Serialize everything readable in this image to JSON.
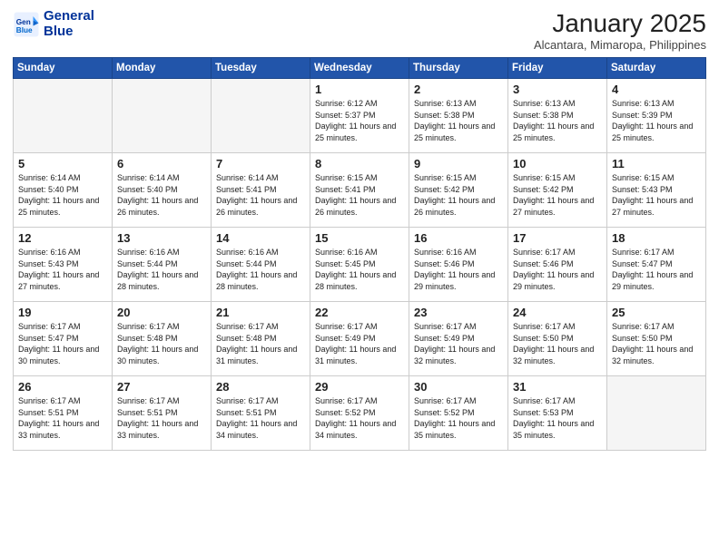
{
  "logo": {
    "line1": "General",
    "line2": "Blue"
  },
  "title": "January 2025",
  "location": "Alcantara, Mimaropa, Philippines",
  "weekdays": [
    "Sunday",
    "Monday",
    "Tuesday",
    "Wednesday",
    "Thursday",
    "Friday",
    "Saturday"
  ],
  "weeks": [
    [
      {
        "day": "",
        "info": ""
      },
      {
        "day": "",
        "info": ""
      },
      {
        "day": "",
        "info": ""
      },
      {
        "day": "1",
        "info": "Sunrise: 6:12 AM\nSunset: 5:37 PM\nDaylight: 11 hours\nand 25 minutes."
      },
      {
        "day": "2",
        "info": "Sunrise: 6:13 AM\nSunset: 5:38 PM\nDaylight: 11 hours\nand 25 minutes."
      },
      {
        "day": "3",
        "info": "Sunrise: 6:13 AM\nSunset: 5:38 PM\nDaylight: 11 hours\nand 25 minutes."
      },
      {
        "day": "4",
        "info": "Sunrise: 6:13 AM\nSunset: 5:39 PM\nDaylight: 11 hours\nand 25 minutes."
      }
    ],
    [
      {
        "day": "5",
        "info": "Sunrise: 6:14 AM\nSunset: 5:40 PM\nDaylight: 11 hours\nand 25 minutes."
      },
      {
        "day": "6",
        "info": "Sunrise: 6:14 AM\nSunset: 5:40 PM\nDaylight: 11 hours\nand 26 minutes."
      },
      {
        "day": "7",
        "info": "Sunrise: 6:14 AM\nSunset: 5:41 PM\nDaylight: 11 hours\nand 26 minutes."
      },
      {
        "day": "8",
        "info": "Sunrise: 6:15 AM\nSunset: 5:41 PM\nDaylight: 11 hours\nand 26 minutes."
      },
      {
        "day": "9",
        "info": "Sunrise: 6:15 AM\nSunset: 5:42 PM\nDaylight: 11 hours\nand 26 minutes."
      },
      {
        "day": "10",
        "info": "Sunrise: 6:15 AM\nSunset: 5:42 PM\nDaylight: 11 hours\nand 27 minutes."
      },
      {
        "day": "11",
        "info": "Sunrise: 6:15 AM\nSunset: 5:43 PM\nDaylight: 11 hours\nand 27 minutes."
      }
    ],
    [
      {
        "day": "12",
        "info": "Sunrise: 6:16 AM\nSunset: 5:43 PM\nDaylight: 11 hours\nand 27 minutes."
      },
      {
        "day": "13",
        "info": "Sunrise: 6:16 AM\nSunset: 5:44 PM\nDaylight: 11 hours\nand 28 minutes."
      },
      {
        "day": "14",
        "info": "Sunrise: 6:16 AM\nSunset: 5:44 PM\nDaylight: 11 hours\nand 28 minutes."
      },
      {
        "day": "15",
        "info": "Sunrise: 6:16 AM\nSunset: 5:45 PM\nDaylight: 11 hours\nand 28 minutes."
      },
      {
        "day": "16",
        "info": "Sunrise: 6:16 AM\nSunset: 5:46 PM\nDaylight: 11 hours\nand 29 minutes."
      },
      {
        "day": "17",
        "info": "Sunrise: 6:17 AM\nSunset: 5:46 PM\nDaylight: 11 hours\nand 29 minutes."
      },
      {
        "day": "18",
        "info": "Sunrise: 6:17 AM\nSunset: 5:47 PM\nDaylight: 11 hours\nand 29 minutes."
      }
    ],
    [
      {
        "day": "19",
        "info": "Sunrise: 6:17 AM\nSunset: 5:47 PM\nDaylight: 11 hours\nand 30 minutes."
      },
      {
        "day": "20",
        "info": "Sunrise: 6:17 AM\nSunset: 5:48 PM\nDaylight: 11 hours\nand 30 minutes."
      },
      {
        "day": "21",
        "info": "Sunrise: 6:17 AM\nSunset: 5:48 PM\nDaylight: 11 hours\nand 31 minutes."
      },
      {
        "day": "22",
        "info": "Sunrise: 6:17 AM\nSunset: 5:49 PM\nDaylight: 11 hours\nand 31 minutes."
      },
      {
        "day": "23",
        "info": "Sunrise: 6:17 AM\nSunset: 5:49 PM\nDaylight: 11 hours\nand 32 minutes."
      },
      {
        "day": "24",
        "info": "Sunrise: 6:17 AM\nSunset: 5:50 PM\nDaylight: 11 hours\nand 32 minutes."
      },
      {
        "day": "25",
        "info": "Sunrise: 6:17 AM\nSunset: 5:50 PM\nDaylight: 11 hours\nand 32 minutes."
      }
    ],
    [
      {
        "day": "26",
        "info": "Sunrise: 6:17 AM\nSunset: 5:51 PM\nDaylight: 11 hours\nand 33 minutes."
      },
      {
        "day": "27",
        "info": "Sunrise: 6:17 AM\nSunset: 5:51 PM\nDaylight: 11 hours\nand 33 minutes."
      },
      {
        "day": "28",
        "info": "Sunrise: 6:17 AM\nSunset: 5:51 PM\nDaylight: 11 hours\nand 34 minutes."
      },
      {
        "day": "29",
        "info": "Sunrise: 6:17 AM\nSunset: 5:52 PM\nDaylight: 11 hours\nand 34 minutes."
      },
      {
        "day": "30",
        "info": "Sunrise: 6:17 AM\nSunset: 5:52 PM\nDaylight: 11 hours\nand 35 minutes."
      },
      {
        "day": "31",
        "info": "Sunrise: 6:17 AM\nSunset: 5:53 PM\nDaylight: 11 hours\nand 35 minutes."
      },
      {
        "day": "",
        "info": ""
      }
    ]
  ]
}
